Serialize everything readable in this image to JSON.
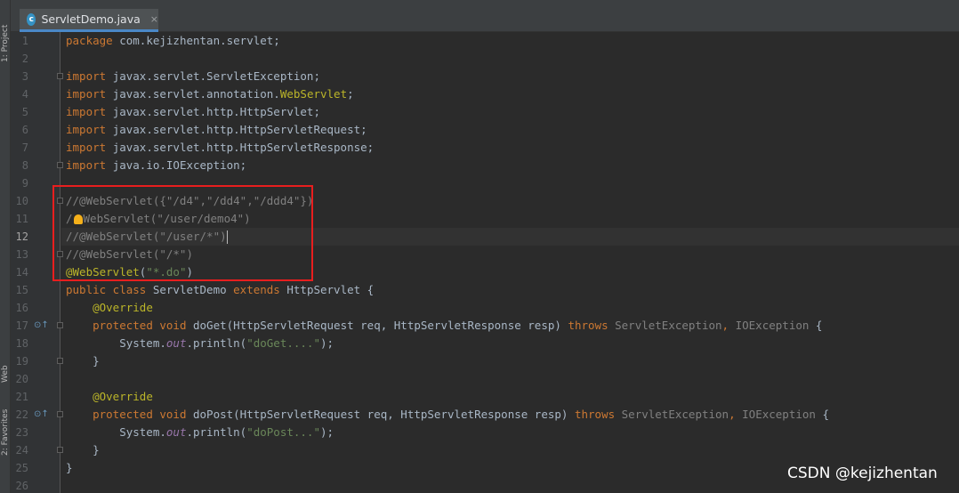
{
  "side_panel": {
    "project_tab": "1: Project",
    "web_tab": "Web",
    "favorites_tab": "2: Favorites"
  },
  "tab_bar": {
    "active_tab": {
      "label": "ServletDemo.java",
      "icon_letter": "c",
      "close_glyph": "×"
    }
  },
  "editor": {
    "current_line": 12,
    "lines": [
      {
        "n": "1",
        "tokens": [
          [
            "kw",
            "package "
          ],
          [
            "pl",
            "com.kejizhentan.servlet;"
          ]
        ]
      },
      {
        "n": "2",
        "tokens": []
      },
      {
        "n": "3",
        "tokens": [
          [
            "kw",
            "import "
          ],
          [
            "pl",
            "javax.servlet.ServletException;"
          ]
        ]
      },
      {
        "n": "4",
        "tokens": [
          [
            "kw",
            "import "
          ],
          [
            "pl",
            "javax.servlet.annotation."
          ],
          [
            "an",
            "WebServlet"
          ],
          [
            "pl",
            ";"
          ]
        ]
      },
      {
        "n": "5",
        "tokens": [
          [
            "kw",
            "import "
          ],
          [
            "pl",
            "javax.servlet.http.HttpServlet;"
          ]
        ]
      },
      {
        "n": "6",
        "tokens": [
          [
            "kw",
            "import "
          ],
          [
            "pl",
            "javax.servlet.http.HttpServletRequest;"
          ]
        ]
      },
      {
        "n": "7",
        "tokens": [
          [
            "kw",
            "import "
          ],
          [
            "pl",
            "javax.servlet.http.HttpServletResponse;"
          ]
        ]
      },
      {
        "n": "8",
        "tokens": [
          [
            "kw",
            "import "
          ],
          [
            "pl",
            "java.io.IOException;"
          ]
        ]
      },
      {
        "n": "9",
        "tokens": []
      },
      {
        "n": "10",
        "tokens": [
          [
            "cm",
            "//@WebServlet({\"/d4\",\"/dd4\",\"/ddd4\"})"
          ]
        ]
      },
      {
        "n": "11",
        "tokens": [
          [
            "cm",
            "/"
          ],
          [
            "bulb",
            ""
          ],
          [
            "cm",
            "WebServlet(\"/user/demo4\")"
          ]
        ]
      },
      {
        "n": "12",
        "tokens": [
          [
            "cm",
            "//@WebServlet(\"/user/*\")"
          ],
          [
            "caret",
            ""
          ]
        ]
      },
      {
        "n": "13",
        "tokens": [
          [
            "cm",
            "//@WebServlet(\"/*\")"
          ]
        ]
      },
      {
        "n": "14",
        "tokens": [
          [
            "an",
            "@WebServlet"
          ],
          [
            "pl",
            "("
          ],
          [
            "st",
            "\"*.do\""
          ],
          [
            "pl",
            ")"
          ]
        ]
      },
      {
        "n": "15",
        "tokens": [
          [
            "kw",
            "public class "
          ],
          [
            "pl",
            "ServletDemo "
          ],
          [
            "kw",
            "extends "
          ],
          [
            "pl",
            "HttpServlet {"
          ]
        ]
      },
      {
        "n": "16",
        "tokens": [
          [
            "pl",
            "    "
          ],
          [
            "an",
            "@Override"
          ]
        ]
      },
      {
        "n": "17",
        "tokens": [
          [
            "pl",
            "    "
          ],
          [
            "kw",
            "protected void "
          ],
          [
            "pl",
            "doGet(HttpServletRequest req, HttpServletResponse resp) "
          ],
          [
            "kw",
            "throws "
          ],
          [
            "cm",
            "ServletException"
          ],
          [
            "kw",
            ", "
          ],
          [
            "cm",
            "IOException"
          ],
          [
            "pl",
            " {"
          ]
        ]
      },
      {
        "n": "18",
        "tokens": [
          [
            "pl",
            "        System."
          ],
          [
            "fld",
            "out"
          ],
          [
            "pl",
            ".println("
          ],
          [
            "st",
            "\"doGet....\""
          ],
          [
            "pl",
            ");"
          ]
        ]
      },
      {
        "n": "19",
        "tokens": [
          [
            "pl",
            "    }"
          ]
        ]
      },
      {
        "n": "20",
        "tokens": []
      },
      {
        "n": "21",
        "tokens": [
          [
            "pl",
            "    "
          ],
          [
            "an",
            "@Override"
          ]
        ]
      },
      {
        "n": "22",
        "tokens": [
          [
            "pl",
            "    "
          ],
          [
            "kw",
            "protected void "
          ],
          [
            "pl",
            "doPost(HttpServletRequest req, HttpServletResponse resp) "
          ],
          [
            "kw",
            "throws "
          ],
          [
            "cm",
            "ServletException"
          ],
          [
            "kw",
            ", "
          ],
          [
            "cm",
            "IOException"
          ],
          [
            "pl",
            " {"
          ]
        ]
      },
      {
        "n": "23",
        "tokens": [
          [
            "pl",
            "        System."
          ],
          [
            "fld",
            "out"
          ],
          [
            "pl",
            ".println("
          ],
          [
            "st",
            "\"doPost...\""
          ],
          [
            "pl",
            ");"
          ]
        ]
      },
      {
        "n": "24",
        "tokens": [
          [
            "pl",
            "    }"
          ]
        ]
      },
      {
        "n": "25",
        "tokens": [
          [
            "pl",
            "}"
          ]
        ]
      },
      {
        "n": "26",
        "tokens": []
      }
    ],
    "fold_lines": [
      3,
      8,
      10,
      13,
      17,
      19,
      22,
      24
    ],
    "override_marker_lines": [
      17,
      22
    ],
    "override_marker_glyph": "⊙↑"
  },
  "watermark": "CSDN @kejizhentan",
  "colors": {
    "keyword": "#cc7832",
    "comment": "#808080",
    "annotation": "#bbb529",
    "string": "#6a8759",
    "highlight_box": "#e81e1e"
  }
}
